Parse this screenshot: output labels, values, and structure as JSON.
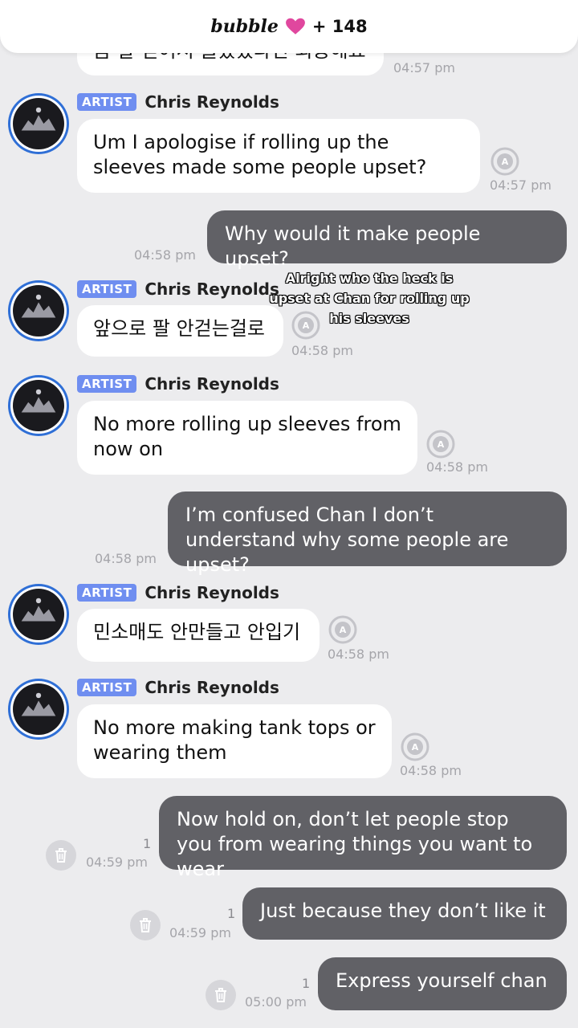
{
  "header": {
    "app_name": "bubble",
    "count": "+ 148"
  },
  "colors": {
    "artist_badge": "#6f8ef0",
    "outgoing_bubble": "#616166",
    "incoming_bubble": "#ffffff",
    "heart": "#e0479e"
  },
  "overlay_caption": "Alright who the heck is upset at Chan for rolling up his sleeves",
  "messages": {
    "m0": {
      "text": "음 팔 걷어서 놀랐었다면 죄송해요",
      "time": "04:57 pm"
    },
    "m1": {
      "badge": "ARTIST",
      "sender": "Chris Reynolds",
      "text": "Um I apologise if rolling up the sleeves made some people upset?",
      "time": "04:57 pm"
    },
    "m2": {
      "text": "Why would it make people upset?",
      "time": "04:58 pm"
    },
    "m3": {
      "badge": "ARTIST",
      "sender": "Chris Reynolds",
      "text": "앞으로 팔 안걷는걸로",
      "time": "04:58 pm"
    },
    "m4": {
      "badge": "ARTIST",
      "sender": "Chris Reynolds",
      "text": "No more rolling up sleeves from now on",
      "time": "04:58 pm"
    },
    "m5": {
      "text": "I’m confused Chan I don’t understand why some people are upset?",
      "time": "04:58 pm"
    },
    "m6": {
      "badge": "ARTIST",
      "sender": "Chris Reynolds",
      "text": "민소매도 안만들고 안입기",
      "time": "04:58 pm"
    },
    "m7": {
      "badge": "ARTIST",
      "sender": "Chris Reynolds",
      "text": "No more making tank tops or wearing them",
      "time": "04:58 pm"
    },
    "m8": {
      "text": "Now hold on, don’t let people stop you from wearing things you want to wear",
      "time": "04:59 pm",
      "unread": "1"
    },
    "m9": {
      "text": "Just because they don’t like it",
      "time": "04:59 pm",
      "unread": "1"
    },
    "m10": {
      "text": "Express yourself chan",
      "time": "05:00 pm",
      "unread": "1"
    }
  }
}
